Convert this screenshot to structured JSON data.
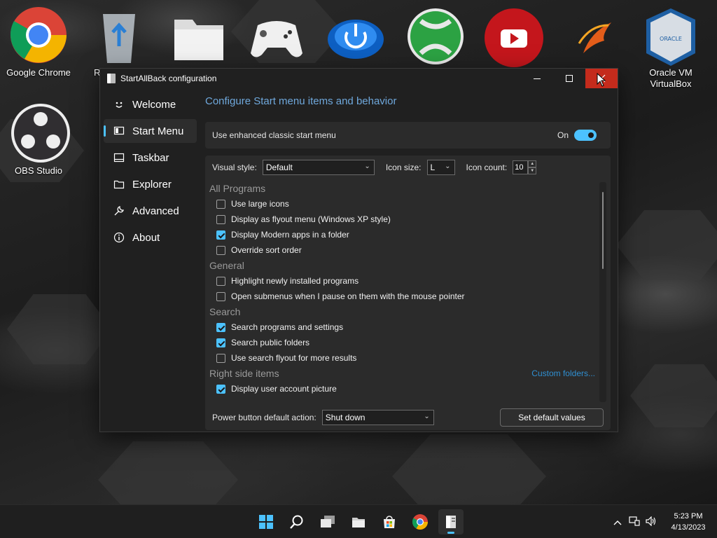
{
  "desktop": {
    "icons": [
      {
        "label": "Google Chrome",
        "icon": "chrome-icon"
      },
      {
        "label": "R",
        "icon": "recycle-bin-icon"
      },
      {
        "label": "",
        "icon": "folder-icon"
      },
      {
        "label": "",
        "icon": "gamepad-icon"
      },
      {
        "label": "",
        "icon": "power-icon"
      },
      {
        "label": "",
        "icon": "xbox-icon"
      },
      {
        "label": "",
        "icon": "youtube-icon"
      },
      {
        "label": "",
        "icon": "phoenix-icon"
      },
      {
        "label": "Oracle VM VirtualBox",
        "icon": "virtualbox-icon"
      },
      {
        "label": "OBS Studio",
        "icon": "obs-icon"
      }
    ]
  },
  "window": {
    "title": "StartAllBack configuration",
    "controls": {
      "minimize": "minimize",
      "maximize": "maximize",
      "close": "close"
    },
    "sidebar": {
      "items": [
        {
          "label": "Welcome",
          "icon": "smiley-icon"
        },
        {
          "label": "Start Menu",
          "icon": "start-menu-icon"
        },
        {
          "label": "Taskbar",
          "icon": "taskbar-icon"
        },
        {
          "label": "Explorer",
          "icon": "folder-icon"
        },
        {
          "label": "Advanced",
          "icon": "wrench-icon"
        },
        {
          "label": "About",
          "icon": "info-icon"
        }
      ],
      "active": "Start Menu"
    },
    "heading": "Configure Start menu items and behavior",
    "enhanced": {
      "label": "Use enhanced classic start menu",
      "state_label": "On",
      "enabled": true
    },
    "style_row": {
      "visual_style_label": "Visual style:",
      "visual_style_value": "Default",
      "icon_size_label": "Icon size:",
      "icon_size_value": "L",
      "icon_count_label": "Icon count:",
      "icon_count_value": "10"
    },
    "groups": {
      "all_programs": {
        "title": "All Programs",
        "options": [
          {
            "label": "Use large icons",
            "checked": false
          },
          {
            "label": "Display as flyout menu (Windows XP style)",
            "checked": false
          },
          {
            "label": "Display Modern apps in a folder",
            "checked": true
          },
          {
            "label": "Override sort order",
            "checked": false
          }
        ]
      },
      "general": {
        "title": "General",
        "options": [
          {
            "label": "Highlight newly installed programs",
            "checked": false
          },
          {
            "label": "Open submenus when I pause on them with the mouse pointer",
            "checked": false
          }
        ]
      },
      "search": {
        "title": "Search",
        "options": [
          {
            "label": "Search programs and settings",
            "checked": true
          },
          {
            "label": "Search public folders",
            "checked": true
          },
          {
            "label": "Use search flyout for more results",
            "checked": false
          }
        ]
      },
      "right_side": {
        "title": "Right side items",
        "link": "Custom folders...",
        "options": [
          {
            "label": "Display user account picture",
            "checked": true
          }
        ]
      }
    },
    "power": {
      "label": "Power button default action:",
      "value": "Shut down"
    },
    "default_button": "Set default values"
  },
  "taskbar": {
    "icons": [
      "windows-start-icon",
      "search-icon",
      "task-view-icon",
      "file-explorer-icon",
      "store-icon",
      "chrome-icon",
      "startallback-icon"
    ],
    "active": "startallback-icon",
    "clock_time": "5:23 PM",
    "clock_date": "4/13/2023"
  },
  "colors": {
    "accent": "#4cc2ff",
    "close_red": "#c42b1c",
    "heading": "#6fa8dc",
    "link": "#2f8fd1"
  }
}
